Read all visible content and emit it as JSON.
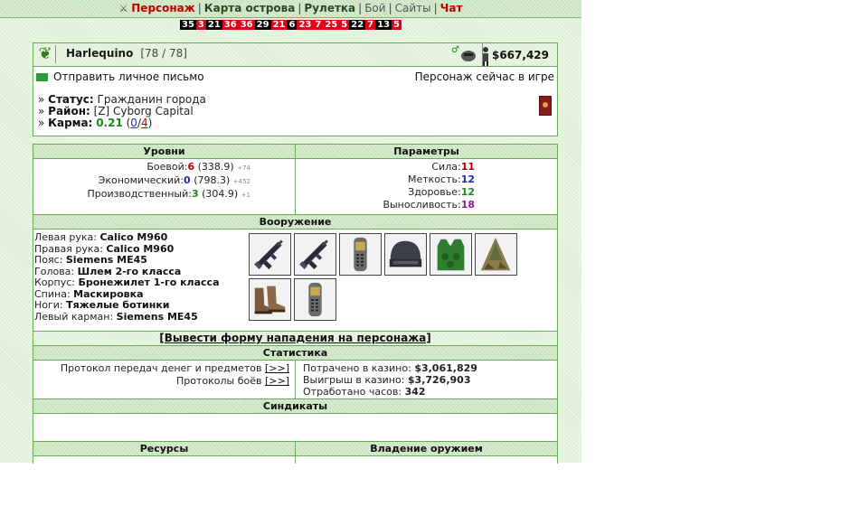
{
  "nav": {
    "items": [
      {
        "label": "Персонаж",
        "style": "red"
      },
      {
        "label": "Карта острова",
        "style": "bold"
      },
      {
        "label": "Рулетка",
        "style": "bold"
      },
      {
        "label": "Бой",
        "style": "plain"
      },
      {
        "label": "Сайты",
        "style": "plain"
      },
      {
        "label": "Чат",
        "style": "red"
      }
    ]
  },
  "counters": [
    {
      "v": "35",
      "c": "k"
    },
    {
      "v": "3",
      "c": "r"
    },
    {
      "v": "21",
      "c": "k"
    },
    {
      "v": "36",
      "c": "r"
    },
    {
      "v": "36",
      "c": "r"
    },
    {
      "v": "29",
      "c": "k"
    },
    {
      "v": "21",
      "c": "r"
    },
    {
      "v": "6",
      "c": "k"
    },
    {
      "v": "23",
      "c": "r"
    },
    {
      "v": "7",
      "c": "r"
    },
    {
      "v": "25",
      "c": "r"
    },
    {
      "v": "5",
      "c": "r"
    },
    {
      "v": "22",
      "c": "k"
    },
    {
      "v": "7",
      "c": "r"
    },
    {
      "v": "13",
      "c": "k"
    },
    {
      "v": "5",
      "c": "r"
    }
  ],
  "profile": {
    "nick": "Harlequino",
    "hp": "[78 / 78]",
    "money": "$667,429",
    "send_mail": "Отправить личное письмо",
    "online": "Персонаж сейчас в игре",
    "status_label": "Статус:",
    "status_value": "Гражданин города",
    "district_label": "Район:",
    "district_value": "[Z] Cyborg Capital",
    "karma_label": "Карма:",
    "karma_value": "0.21",
    "karma_pos": "0",
    "karma_neg": "4"
  },
  "levels": {
    "header": "Уровни",
    "rows": [
      {
        "label": "Боевой:",
        "level": "6",
        "exp": "(338.9)",
        "delta": "+74",
        "color": "c-red"
      },
      {
        "label": "Экономический:",
        "level": "0",
        "exp": "(798.3)",
        "delta": "+452",
        "color": "c-blue"
      },
      {
        "label": "Производственный:",
        "level": "3",
        "exp": "(304.9)",
        "delta": "+1",
        "color": "c-green"
      }
    ]
  },
  "params": {
    "header": "Параметры",
    "rows": [
      {
        "label": "Сила:",
        "value": "11",
        "color": "c-red"
      },
      {
        "label": "Меткость:",
        "value": "12",
        "color": "c-blue"
      },
      {
        "label": "Здоровье:",
        "value": "12",
        "color": "c-green"
      },
      {
        "label": "Выносливость:",
        "value": "18",
        "color": "c-purple"
      }
    ]
  },
  "equipment": {
    "header": "Вооружение",
    "items": [
      {
        "slot": "Левая рука:",
        "item": "Calico M960"
      },
      {
        "slot": "Правая рука:",
        "item": "Calico M960"
      },
      {
        "slot": "Пояс:",
        "item": "Siemens ME45"
      },
      {
        "slot": "Голова:",
        "item": "Шлем 2-го класса"
      },
      {
        "slot": "Корпус:",
        "item": "Бронежилет 1-го класса"
      },
      {
        "slot": "Спина:",
        "item": "Маскировка"
      },
      {
        "slot": "Ноги:",
        "item": "Тяжелые ботинки"
      },
      {
        "slot": "Левый карман:",
        "item": "Siemens ME45"
      }
    ],
    "icons": [
      "rifle-icon",
      "rifle-icon",
      "phone-icon",
      "helmet-icon",
      "vest-icon",
      "camouflage-icon",
      "boots-icon",
      "phone-icon"
    ],
    "attack_link": "[Вывести форму нападения на персонажа]"
  },
  "stats": {
    "header": "Статистика",
    "money_protocol": "Протокол передач денег и предметов",
    "battle_protocol": "Протоколы боёв",
    "link": "[>>]",
    "spent_label": "Потрачено в казино:",
    "spent_value": "$3,061,829",
    "won_label": "Выигрыш в казино:",
    "won_value": "$3,726,903",
    "hours_label": "Отработано часов:",
    "hours_value": "342"
  },
  "syndicates": {
    "header": "Синдикаты"
  },
  "resources": {
    "header": "Ресурсы"
  },
  "weapon_skill": {
    "header": "Владение оружием"
  }
}
